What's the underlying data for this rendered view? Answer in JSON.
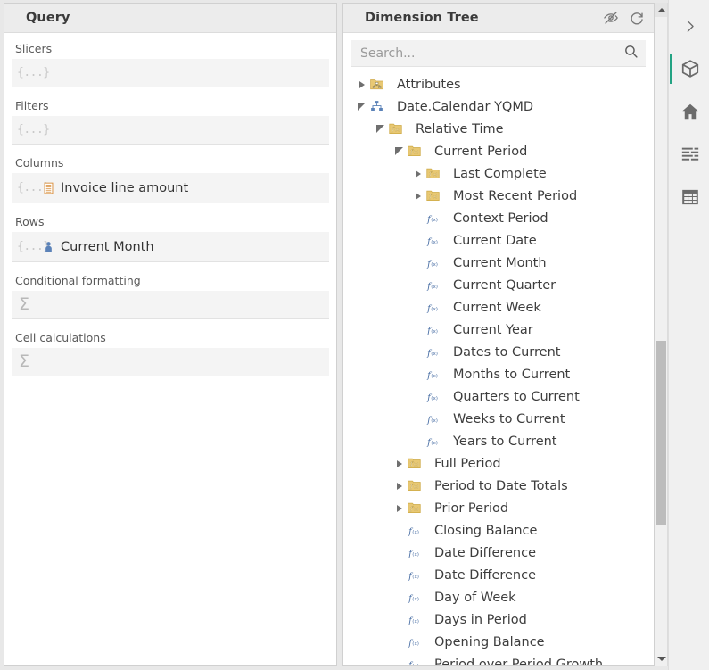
{
  "query_panel": {
    "title": "Query",
    "placeholder_braces": "{...}",
    "sigma_glyph": "Σ",
    "sections": [
      {
        "label": "Slicers",
        "slot_type": "braces",
        "item": null
      },
      {
        "label": "Filters",
        "slot_type": "braces",
        "item": null
      },
      {
        "label": "Columns",
        "slot_type": "braces",
        "item": {
          "text": "Invoice line amount",
          "icon": "measure-icon"
        }
      },
      {
        "label": "Rows",
        "slot_type": "braces",
        "item": {
          "text": "Current Month",
          "icon": "member-icon"
        }
      },
      {
        "label": "Conditional formatting",
        "slot_type": "sigma",
        "item": null
      },
      {
        "label": "Cell calculations",
        "slot_type": "sigma",
        "item": null
      }
    ]
  },
  "tree_panel": {
    "title": "Dimension Tree",
    "header_icons": [
      {
        "name": "hide-empty-icon",
        "glyph": "eye-off"
      },
      {
        "name": "refresh-icon",
        "glyph": "refresh"
      }
    ],
    "search": {
      "placeholder": "Search...",
      "value": "",
      "icon": "search-icon"
    },
    "nodes": [
      {
        "label": "Attributes",
        "depth": 0,
        "state": "collapsed",
        "icon": "attributes-folder-icon"
      },
      {
        "label": "Date.Calendar YQMD",
        "depth": 0,
        "state": "expanded",
        "icon": "hierarchy-icon"
      },
      {
        "label": "Relative Time",
        "depth": 1,
        "state": "expanded",
        "icon": "fx-folder-icon"
      },
      {
        "label": "Current Period",
        "depth": 2,
        "state": "expanded",
        "icon": "fx-folder-icon"
      },
      {
        "label": "Last Complete",
        "depth": 3,
        "state": "collapsed",
        "icon": "fx-folder-icon"
      },
      {
        "label": "Most Recent Period",
        "depth": 3,
        "state": "collapsed",
        "icon": "fx-folder-icon"
      },
      {
        "label": "Context Period",
        "depth": 3,
        "state": "leaf",
        "icon": "fx-icon"
      },
      {
        "label": "Current Date",
        "depth": 3,
        "state": "leaf",
        "icon": "fx-icon"
      },
      {
        "label": "Current Month",
        "depth": 3,
        "state": "leaf",
        "icon": "fx-icon"
      },
      {
        "label": "Current Quarter",
        "depth": 3,
        "state": "leaf",
        "icon": "fx-icon"
      },
      {
        "label": "Current Week",
        "depth": 3,
        "state": "leaf",
        "icon": "fx-icon"
      },
      {
        "label": "Current Year",
        "depth": 3,
        "state": "leaf",
        "icon": "fx-icon"
      },
      {
        "label": "Dates to Current",
        "depth": 3,
        "state": "leaf",
        "icon": "fx-icon"
      },
      {
        "label": "Months to Current",
        "depth": 3,
        "state": "leaf",
        "icon": "fx-icon"
      },
      {
        "label": "Quarters to Current",
        "depth": 3,
        "state": "leaf",
        "icon": "fx-icon"
      },
      {
        "label": "Weeks to Current",
        "depth": 3,
        "state": "leaf",
        "icon": "fx-icon"
      },
      {
        "label": "Years to Current",
        "depth": 3,
        "state": "leaf",
        "icon": "fx-icon"
      },
      {
        "label": "Full Period",
        "depth": 2,
        "state": "collapsed",
        "icon": "fx-folder-icon"
      },
      {
        "label": "Period to Date Totals",
        "depth": 2,
        "state": "collapsed",
        "icon": "fx-folder-icon"
      },
      {
        "label": "Prior Period",
        "depth": 2,
        "state": "collapsed",
        "icon": "fx-folder-icon"
      },
      {
        "label": "Closing Balance",
        "depth": 2,
        "state": "leaf",
        "icon": "fx-icon"
      },
      {
        "label": "Date Difference",
        "depth": 2,
        "state": "leaf",
        "icon": "fx-icon"
      },
      {
        "label": "Date Difference",
        "depth": 2,
        "state": "leaf",
        "icon": "fx-icon"
      },
      {
        "label": "Day of Week",
        "depth": 2,
        "state": "leaf",
        "icon": "fx-icon"
      },
      {
        "label": "Days in Period",
        "depth": 2,
        "state": "leaf",
        "icon": "fx-icon"
      },
      {
        "label": "Opening Balance",
        "depth": 2,
        "state": "leaf",
        "icon": "fx-icon"
      },
      {
        "label": "Period over Period Growth",
        "depth": 2,
        "state": "leaf",
        "icon": "fx-icon"
      }
    ]
  },
  "scrollbar": {
    "name": "tree-vertical-scrollbar",
    "up_arrow": "scroll-up-arrow",
    "down_arrow": "scroll-down-arrow"
  },
  "rail": {
    "items": [
      {
        "name": "expand-panel-button",
        "icon": "chevron-right-icon",
        "active": false
      },
      {
        "name": "cube-button",
        "icon": "cube-icon",
        "active": true
      },
      {
        "name": "home-button",
        "icon": "home-icon",
        "active": false
      },
      {
        "name": "list-button",
        "icon": "list-icon",
        "active": false
      },
      {
        "name": "grid-button",
        "icon": "grid-icon",
        "active": false
      }
    ]
  },
  "colors": {
    "accent": "#23a383",
    "folder": "#e8c873",
    "fx": "#4a6fa5",
    "measure": "#d99243",
    "member": "#5b82b8"
  }
}
